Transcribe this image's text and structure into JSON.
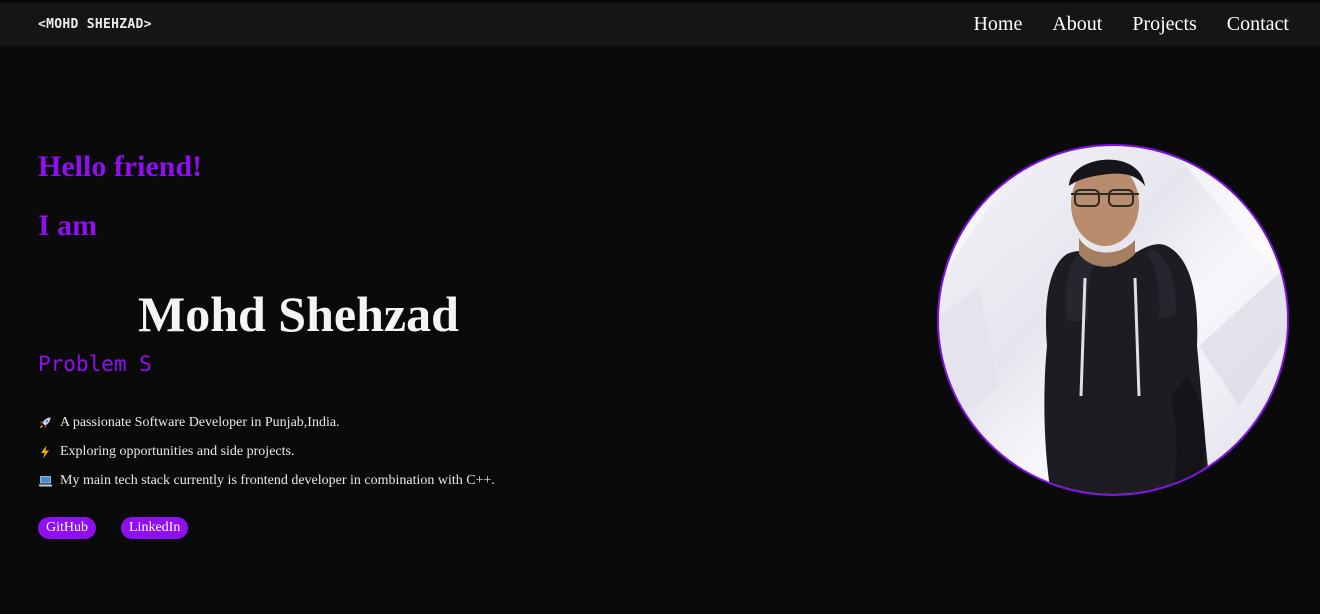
{
  "nav": {
    "logo": "<MOHD SHEHZAD>",
    "links": [
      "Home",
      "About",
      "Projects",
      "Contact"
    ]
  },
  "hero": {
    "greeting": "Hello friend!",
    "iam": "I am",
    "name": "Mohd Shehzad",
    "typing": "Problem S",
    "bullets": [
      {
        "icon": "rocket-icon",
        "text": "A passionate Software Developer in Punjab,India."
      },
      {
        "icon": "lightning-icon",
        "text": "Exploring opportunities and side projects."
      },
      {
        "icon": "laptop-icon",
        "text": "My main tech stack currently is frontend developer in combination with C++."
      }
    ],
    "links": {
      "github": "GitHub",
      "linkedin": "LinkedIn"
    }
  },
  "colors": {
    "accent": "#8f0ff0",
    "background": "#0a0a0b",
    "navbar": "#151515"
  }
}
